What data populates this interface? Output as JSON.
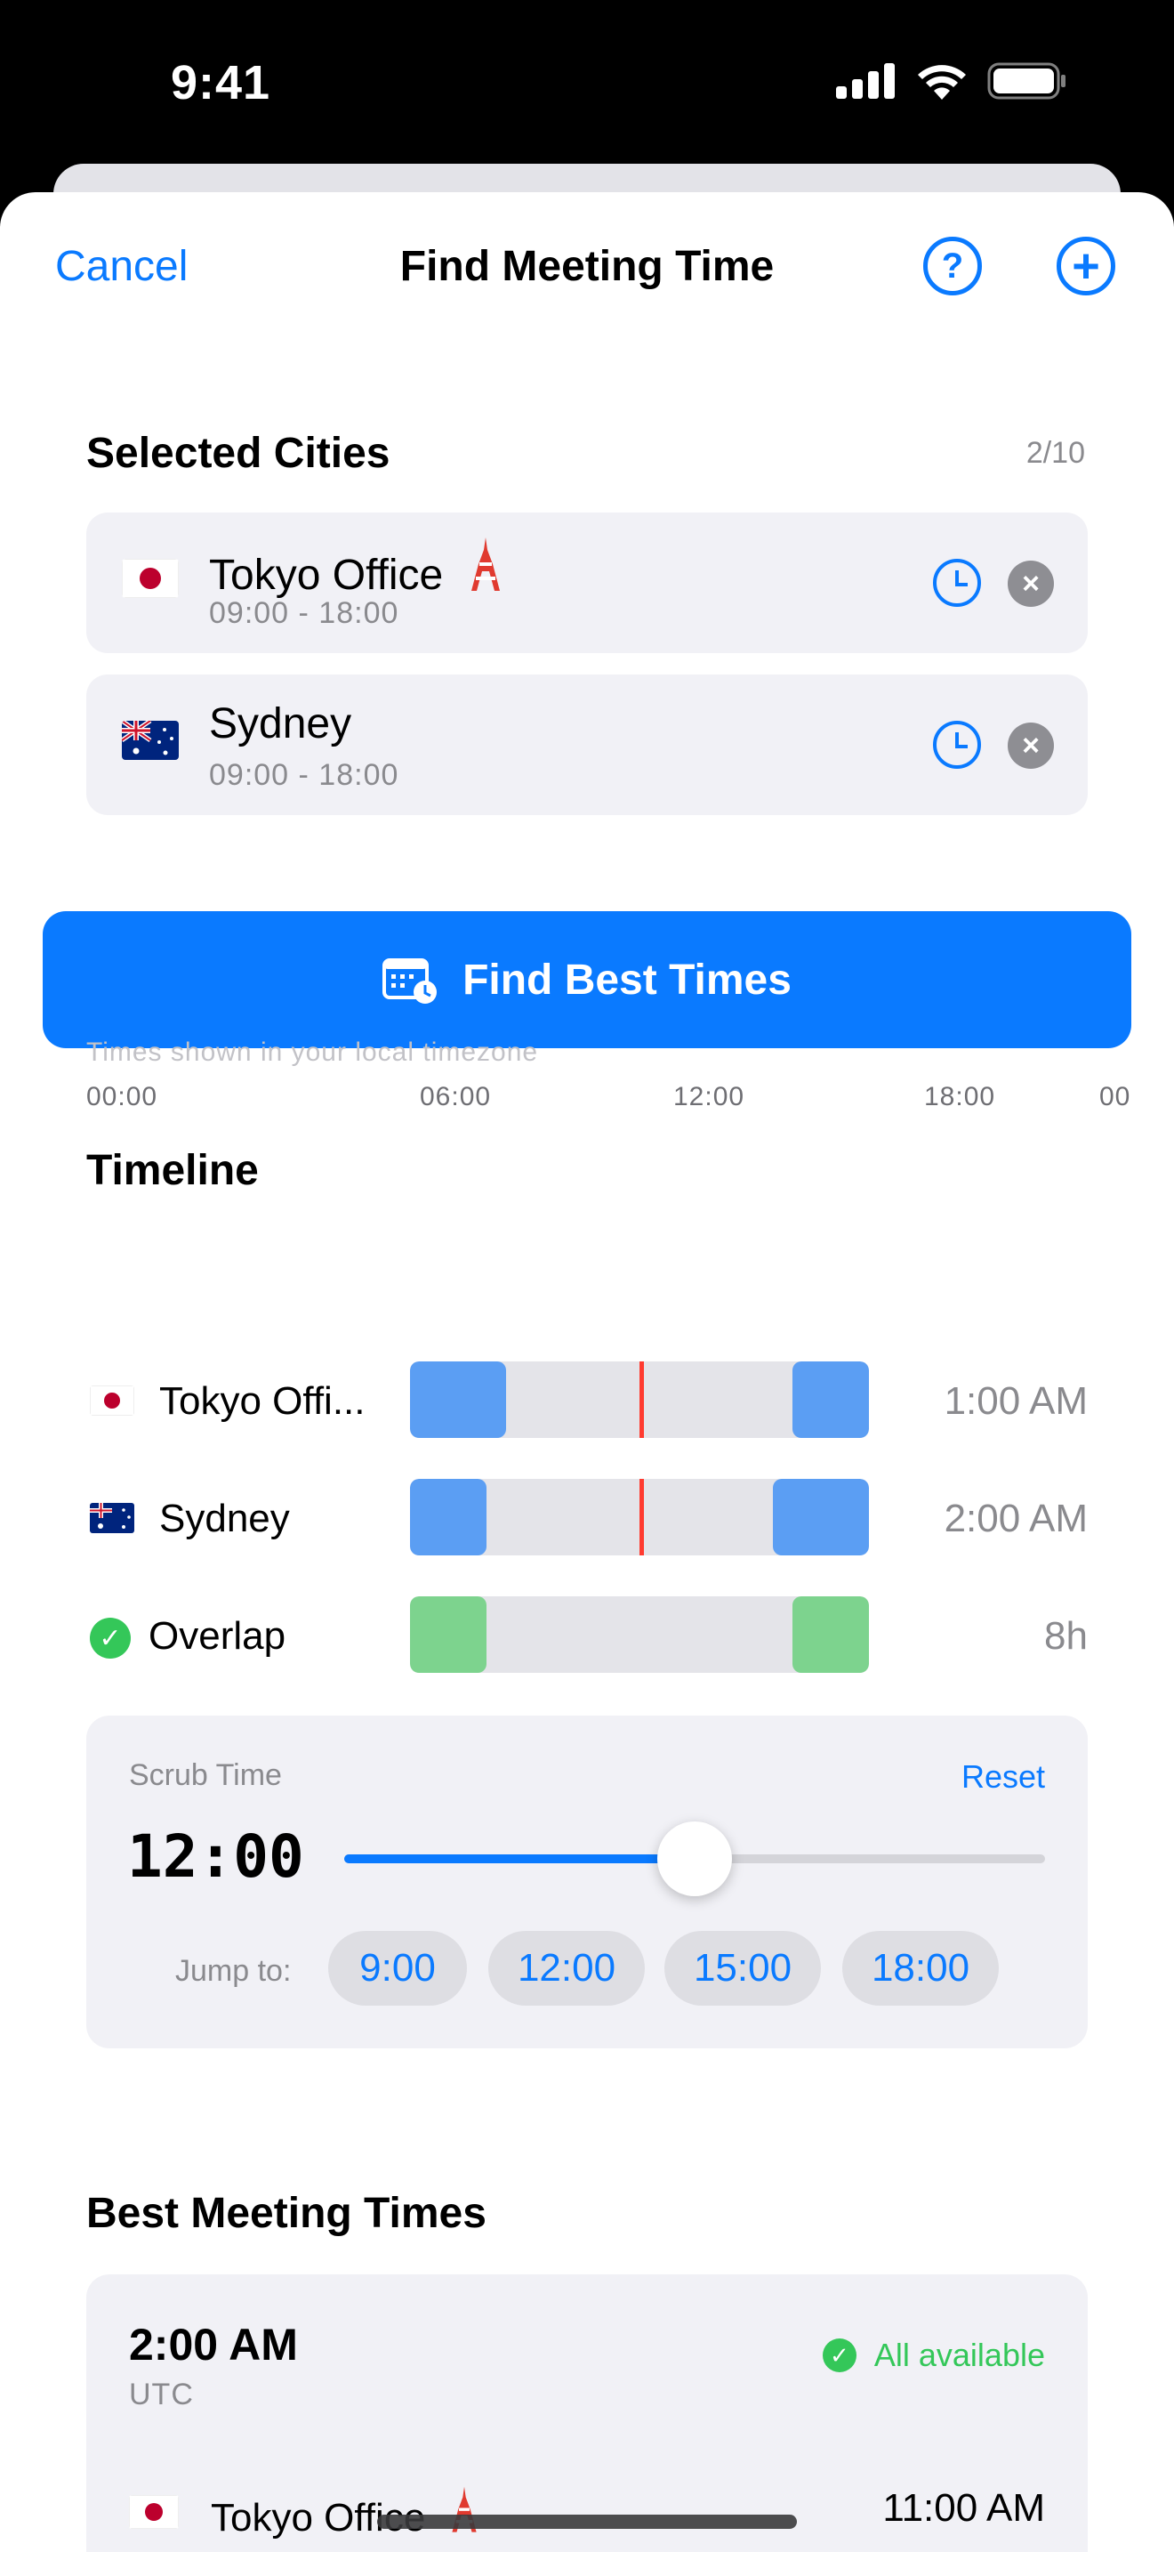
{
  "status_bar": {
    "time": "9:41"
  },
  "nav": {
    "cancel": "Cancel",
    "title": "Find Meeting Time",
    "help_glyph": "?",
    "add_glyph": "+"
  },
  "selected_cities": {
    "title": "Selected Cities",
    "count": "2/10",
    "items": [
      {
        "flag": "japan",
        "name": "Tokyo Office",
        "hours": "09:00 - 18:00",
        "emoji": "tokyo-tower-icon"
      },
      {
        "flag": "australia",
        "name": "Sydney",
        "hours": "09:00 - 18:00"
      }
    ],
    "remove_glyph": "×"
  },
  "find_button": {
    "label": "Find Best Times",
    "icon": "calendar-clock-icon"
  },
  "timeline": {
    "title": "Timeline",
    "note": "Times shown in your local timezone",
    "ticks": [
      "00:00",
      "06:00",
      "12:00",
      "18:00",
      "00"
    ],
    "rows": [
      {
        "flag": "japan",
        "label": "Tokyo Offi...",
        "value": "1:00 AM"
      },
      {
        "flag": "australia",
        "label": "Sydney",
        "value": "2:00 AM"
      },
      {
        "icon": "checkmark-icon",
        "label": "Overlap",
        "value": "8h"
      }
    ],
    "check_glyph": "✓"
  },
  "scrub": {
    "label": "Scrub Time",
    "reset": "Reset",
    "time": "12:00",
    "slider_fraction": 0.5,
    "jump_label": "Jump to:",
    "chips": [
      "9:00",
      "12:00",
      "15:00",
      "18:00"
    ]
  },
  "best_times": {
    "title": "Best Meeting Times",
    "first": {
      "time": "2:00 AM",
      "tz": "UTC",
      "status": "All available",
      "city_name": "Tokyo Office",
      "city_time": "11:00 AM"
    }
  },
  "colors": {
    "accent": "#0a7aff",
    "success": "#34c759",
    "now_line": "#ff3b30",
    "city_block": "#5b9ef3",
    "overlap_block": "#7dd38e"
  }
}
